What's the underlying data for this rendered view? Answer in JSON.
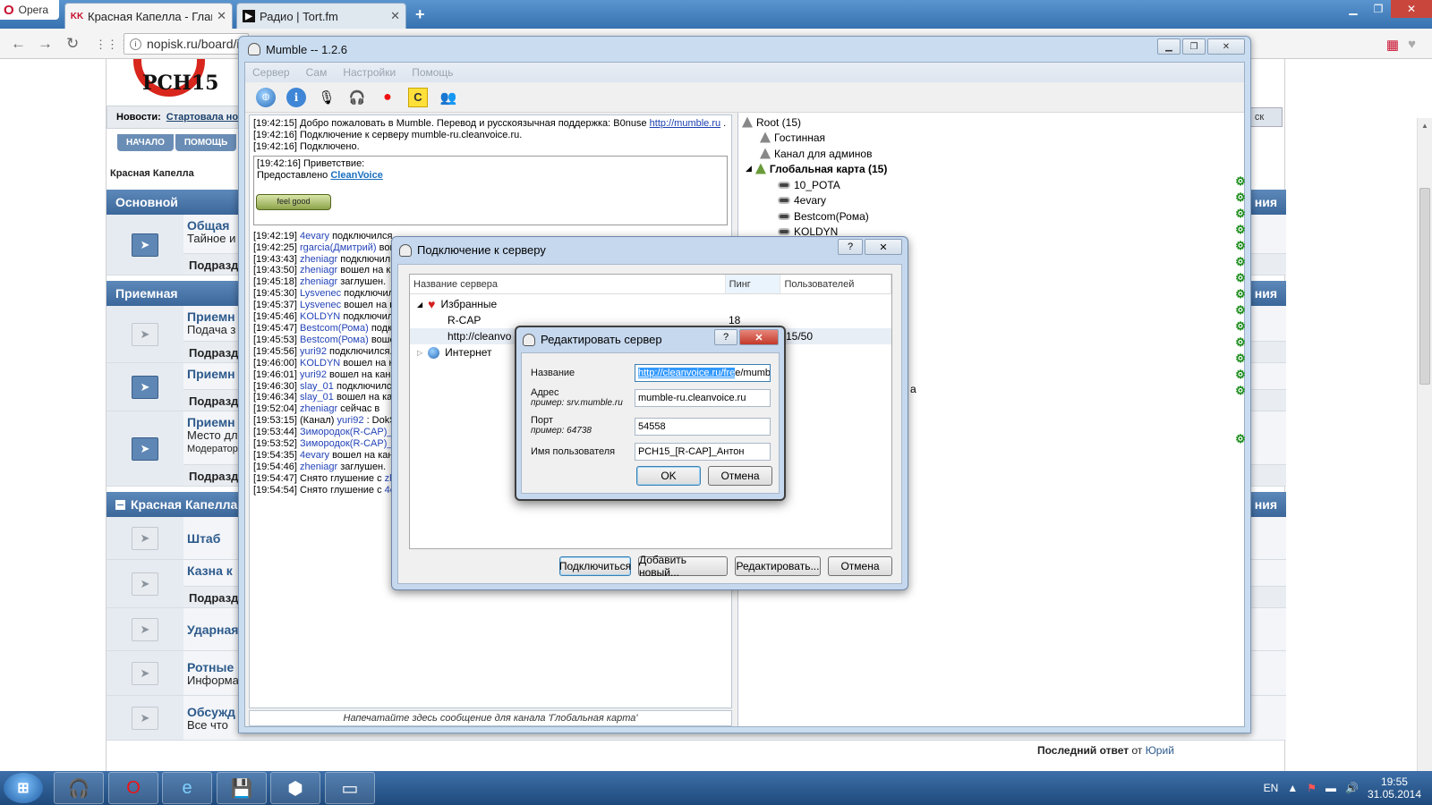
{
  "browser": {
    "app_name": "Opera",
    "tabs": [
      {
        "title": "Красная Капелла - Главная",
        "favicon": "KK"
      },
      {
        "title": "Радио | Tort.fm",
        "favicon": "▶"
      }
    ],
    "url": "nopisk.ru/board/i",
    "new_tab": "+"
  },
  "forum": {
    "logo_text": "РСН15",
    "news_label": "Новости:",
    "news_text": "Стартовала но",
    "nav": [
      "НАЧАЛО",
      "ПОМОЩЬ"
    ],
    "breadcrumb": "Красная Капелла",
    "search_button": "ск",
    "categories": [
      {
        "title": "Основной",
        "right": "ния"
      },
      {
        "title": "Приемная",
        "right": "ния"
      },
      {
        "title": "Красная Капелла",
        "right": "ния"
      }
    ],
    "boards": [
      {
        "title": "Общая",
        "desc": "Тайное и",
        "sub": "Подразд"
      },
      {
        "title": "Приемн",
        "desc": "Подача з",
        "sub": "Подразд"
      },
      {
        "title": "Приемн",
        "desc": "",
        "sub": "Подразд"
      },
      {
        "title": "Приемн",
        "desc": "Место дл",
        "extra": "Модератор",
        "sub": "Подразд"
      },
      {
        "title": "Штаб",
        "desc": ""
      },
      {
        "title": "Казна к",
        "desc": "",
        "sub": "Подразд"
      },
      {
        "title": "Ударная",
        "desc": ""
      },
      {
        "title": "Ротные",
        "desc": "Информа"
      },
      {
        "title": "Обсужд",
        "desc": "Все что"
      }
    ],
    "last_post_label": "Последний ответ",
    "last_post_from": "от",
    "last_post_user": "Юрий"
  },
  "mumble": {
    "title": "Mumble -- 1.2.6",
    "menu": [
      "Сервер",
      "Сам",
      "Настройки",
      "Помощь"
    ],
    "toolbar_icons": [
      "globe-icon",
      "info-icon",
      "microphone-icon",
      "headphones-icon",
      "record-icon",
      "certificate-icon",
      "users-icon"
    ],
    "log_top": [
      {
        "time": "[19:42:15]",
        "text": "Добро пожаловать в Mumble. Перевод и русскоязычная поддержка: B0nuse ",
        "link": "http://mumble.ru",
        "after": " ."
      },
      {
        "time": "[19:42:16]",
        "text": "Подключение к серверу mumble-ru.cleanvoice.ru.",
        "link": "",
        "after": ""
      },
      {
        "time": "[19:42:16]",
        "text": "Подключено.",
        "link": "",
        "after": ""
      }
    ],
    "welcome": {
      "line1": "[19:42:16] Приветствие:",
      "line2": "Предоставлено",
      "cleanvoice": "CleanVoice",
      "badge": "feel good"
    },
    "log": [
      {
        "time": "[19:42:19]",
        "user": "4evary",
        "text": "подключился"
      },
      {
        "time": "[19:42:25]",
        "user": "rgarcia(Дмитрий)",
        "text": "вош"
      },
      {
        "time": "[19:43:43]",
        "user": "zheniagr",
        "text": "подключил"
      },
      {
        "time": "[19:43:50]",
        "user": "zheniagr",
        "text": "вошел на ка"
      },
      {
        "time": "[19:45:18]",
        "user": "zheniagr",
        "text": "заглушен."
      },
      {
        "time": "[19:45:30]",
        "user": "Lysvenec",
        "text": "подключил"
      },
      {
        "time": "[19:45:37]",
        "user": "Lysvenec",
        "text": "вошел на ка"
      },
      {
        "time": "[19:45:46]",
        "user": "KOLDYN",
        "text": "подключился"
      },
      {
        "time": "[19:45:47]",
        "user": "Bestcom(Рома)",
        "text": "подкл"
      },
      {
        "time": "[19:45:53]",
        "user": "Bestcom(Рома)",
        "text": "вошел"
      },
      {
        "time": "[19:45:56]",
        "user": "yuri92",
        "text": "подключился."
      },
      {
        "time": "[19:46:00]",
        "user": "KOLDYN",
        "text": "вошел на кан"
      },
      {
        "time": "[19:46:01]",
        "user": "yuri92",
        "text": "вошел на кана"
      },
      {
        "time": "[19:46:30]",
        "user": "slay_01",
        "text": "подключился"
      },
      {
        "time": "[19:46:34]",
        "user": "slay_01",
        "text": "вошел на кан"
      },
      {
        "time": "[19:52:04]",
        "user": "zheniagr",
        "text": "сейчас в"
      },
      {
        "time": "[19:53:15]",
        "user": "yuri92",
        "text": ": DokSk",
        "prefix": "(Канал) "
      },
      {
        "time": "[19:53:44]",
        "user": "Зимородок(R-CAP)_П",
        "text": ""
      },
      {
        "time": "[19:53:52]",
        "user": "Зимородок(R-CAP)_П",
        "text": ""
      },
      {
        "time": "[19:54:35]",
        "user": "4evary",
        "text": "вошел на кана"
      },
      {
        "time": "[19:54:46]",
        "user": "zheniagr",
        "text": "заглушен."
      },
      {
        "time": "[19:54:47]",
        "user": "zhe",
        "text": "",
        "prefix": "Снято глушение с "
      },
      {
        "time": "[19:54:54]",
        "user": "4e",
        "text": "",
        "prefix": "Снято глушение с "
      }
    ],
    "chat_placeholder": "Напечатайте здесь сообщение для канала 'Глобальная карта'",
    "tree": {
      "root": "Root (15)",
      "channels": [
        "Гостинная",
        "Канал для админов"
      ],
      "expanded_channel": "Глобальная карта (15)",
      "users": [
        "10_POTA",
        "4evary",
        "Bestcom(Рома)",
        "KOLDYN"
      ],
      "partial_text": "а"
    }
  },
  "connect_dialog": {
    "title": "Подключение к серверу",
    "columns": [
      "Название сервера",
      "Пинг",
      "Пользователей"
    ],
    "favorites_label": "Избранные",
    "servers": [
      {
        "name": "R-CAP",
        "ping": "18",
        "users": ""
      },
      {
        "name": "http://cleanvo",
        "ping": "",
        "users": "15/50"
      }
    ],
    "internet_label": "Интернет",
    "buttons": [
      "Подключиться",
      "Добавить новый...",
      "Редактировать...",
      "Отмена"
    ]
  },
  "edit_dialog": {
    "title": "Редактировать сервер",
    "fields": {
      "name_label": "Название",
      "name_selected": "http://cleanvoice.ru/fre",
      "name_rest": "e/mumb",
      "address_label": "Адрес",
      "address_hint": "пример: srv.mumble.ru",
      "address_value": "mumble-ru.cleanvoice.ru",
      "port_label": "Порт",
      "port_hint": "пример: 64738",
      "port_value": "54558",
      "user_label": "Имя пользователя",
      "user_value": "РСН15_[R-CAP]_Антон"
    },
    "ok": "OK",
    "cancel": "Отмена"
  },
  "taskbar": {
    "apps": [
      "mumble-icon",
      "opera-icon",
      "ie-icon",
      "save-icon",
      "tank-icon",
      "notepad-icon"
    ],
    "language": "EN",
    "time": "19:55",
    "date": "31.05.2014"
  }
}
